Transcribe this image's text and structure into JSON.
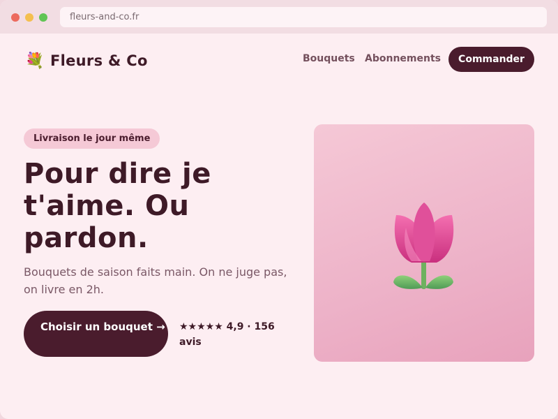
{
  "browser": {
    "url": "fleurs-and-co.fr"
  },
  "header": {
    "brand_icon": "bouquet-icon",
    "brand_icon_glyph": "💐",
    "brand_name": "Fleurs & Co",
    "nav": [
      {
        "label": "Bouquets"
      },
      {
        "label": "Abonnements"
      }
    ],
    "order_label": "Commander"
  },
  "hero": {
    "badge": "Livraison le jour même",
    "title": "Pour dire je t'aime. Ou pardon.",
    "subtitle": "Bouquets de saison faits main. On ne juge pas, on livre en 2h.",
    "cta_label": "Choisir un bouquet →",
    "rating_text": "★★★★★ 4,9 · 156 avis",
    "image_icon": "tulip-icon"
  },
  "colors": {
    "primary": "#4a1c2d",
    "background": "#fdeef2",
    "badge_bg": "#f5c9d6",
    "card_gradient_start": "#f5c8d6",
    "card_gradient_end": "#e8a2bc"
  }
}
